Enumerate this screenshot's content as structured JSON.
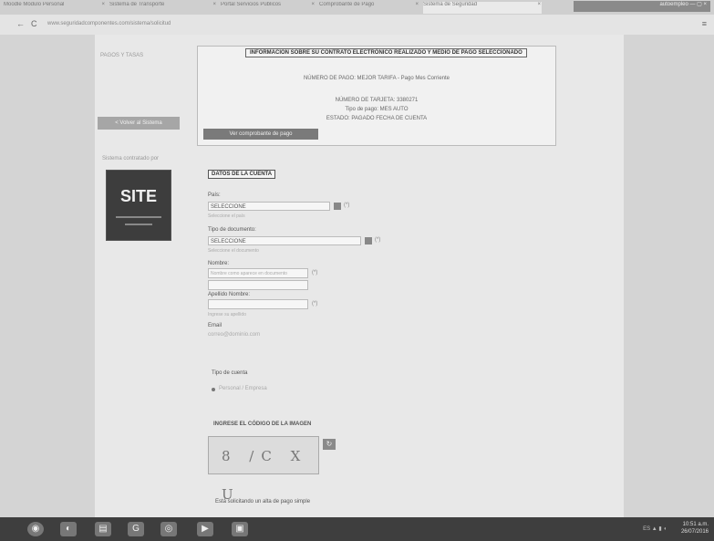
{
  "browser": {
    "tabs": [
      {
        "label": "Moodle Módulo Personal"
      },
      {
        "label": "Sistema de Transporte"
      },
      {
        "label": "Portal Servicios Públicos"
      },
      {
        "label": "Comprobante de Pago"
      },
      {
        "label": "Sistema de Seguridad"
      }
    ],
    "url": "www.seguridadcomponentes.com/sistema/solicitud",
    "window_label": "autoempleo"
  },
  "sidebar": {
    "top_text": "PAGOS Y TASAS",
    "button_label": "< Volver al Sistema",
    "caption": "Sistema contratado por",
    "logo_text": "SITE"
  },
  "info": {
    "title": "INFORMACION SOBRE SU CONTRATO ELECTRÓNICO REALIZADO Y MEDIO DE PAGO SELECCIONADO",
    "lines": [
      "NÚMERO DE PAGO: MEJOR TARIFA - Pago Mes Corriente",
      "",
      "NÚMERO DE TARJETA: 3380271",
      "Tipo de pago: MES AUTO",
      "ESTADO: PAGADO FECHA DE CUENTA"
    ],
    "action_label": "Ver comprobante de pago"
  },
  "form": {
    "section_tag": "DATOS DE LA CUENTA",
    "pais_label": "País:",
    "pais_value": "SELECCIONE",
    "pais_hint": "Seleccione el país",
    "tipo_doc_label": "Tipo de documento:",
    "tipo_doc_value": "SELECCIONE",
    "tipo_doc_hint": "Seleccione el documento",
    "nombre_label": "Nombre:",
    "nombre_hint": "Nombre como aparece en documento",
    "apellido_label": "Apellido Nombre:",
    "apellido_hint": "Ingrese su apellido",
    "email_label": "Email",
    "email_value": "correo@dominio.com",
    "tipo_cuenta_label": "Tipo de cuenta",
    "tipo_cuenta_option": "Personal / Empresa",
    "required_mark": "(*)"
  },
  "captcha": {
    "label": "INGRESE EL CÓDIGO DE LA IMAGEN",
    "code": "8 /C X U",
    "refresh_symbol": "↻",
    "footer": "Está solicitando un alta de pago simple"
  },
  "taskbar": {
    "clock_time": "10:51 a.m.",
    "clock_date": "26/07/2016",
    "tray_label": "ES"
  }
}
